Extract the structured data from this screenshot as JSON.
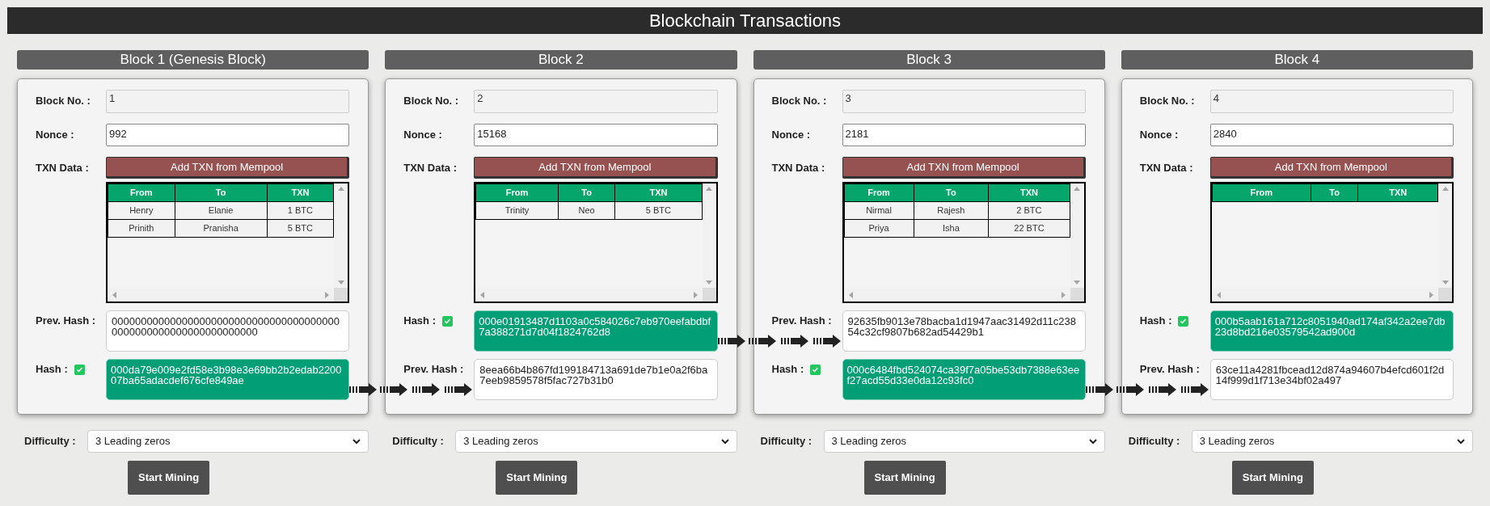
{
  "title": "Blockchain Transactions",
  "blocks": [
    {
      "header": "Block 1 (Genesis Block)",
      "block_no_label": "Block No. :",
      "block_no": "1",
      "nonce_label": "Nonce :",
      "nonce": "992",
      "txn_label": "TXN Data :",
      "add_button": "Add TXN from Mempool",
      "columns": [
        "From",
        "To",
        "TXN"
      ],
      "rows": [
        [
          "Henry",
          "Elanie",
          "1 BTC"
        ],
        [
          "Prinith",
          "Pranisha",
          "5 BTC"
        ]
      ],
      "fields": [
        {
          "kind": "prev_hash",
          "label": "Prev. Hash :",
          "value": "0000000000000000000000000000000000000000000000000000000000000000"
        },
        {
          "kind": "hash",
          "label": "Hash :",
          "checked": true,
          "value": "000da79e009e2fd58e3b98e3e69bb2b2edab220007ba65adacdef676cfe849ae"
        }
      ],
      "difficulty_label": "Difficulty :",
      "difficulty": "3 Leading zeros",
      "mine_button": "Start Mining"
    },
    {
      "header": "Block 2",
      "block_no_label": "Block No. :",
      "block_no": "2",
      "nonce_label": "Nonce :",
      "nonce": "15168",
      "txn_label": "TXN Data :",
      "add_button": "Add TXN from Mempool",
      "columns": [
        "From",
        "To",
        "TXN"
      ],
      "rows": [
        [
          "Trinity",
          "Neo",
          "5 BTC"
        ]
      ],
      "fields": [
        {
          "kind": "hash",
          "label": "Hash :",
          "checked": true,
          "value": "000e01913487d1103a0c584026c7eb970eefabdbf7a388271d7d04f1824762d8"
        },
        {
          "kind": "prev_hash",
          "label": "Prev. Hash :",
          "value": "8eea66b4b867fd199184713a691de7b1e0a2f6ba7eeb9859578f5fac727b31b0"
        }
      ],
      "difficulty_label": "Difficulty :",
      "difficulty": "3 Leading zeros",
      "mine_button": "Start Mining"
    },
    {
      "header": "Block 3",
      "block_no_label": "Block No. :",
      "block_no": "3",
      "nonce_label": "Nonce :",
      "nonce": "2181",
      "txn_label": "TXN Data :",
      "add_button": "Add TXN from Mempool",
      "columns": [
        "From",
        "To",
        "TXN"
      ],
      "rows": [
        [
          "Nirmal",
          "Rajesh",
          "2 BTC"
        ],
        [
          "Priya",
          "Isha",
          "22 BTC"
        ]
      ],
      "fields": [
        {
          "kind": "prev_hash",
          "label": "Prev. Hash :",
          "value": "92635fb9013e78bacba1d1947aac31492d11c23854c32cf9807b682ad54429b1"
        },
        {
          "kind": "hash",
          "label": "Hash :",
          "checked": true,
          "value": "000c6484fbd524074ca39f7a05be53db7388e63eef27acd55d33e0da12c93fc0"
        }
      ],
      "difficulty_label": "Difficulty :",
      "difficulty": "3 Leading zeros",
      "mine_button": "Start Mining"
    },
    {
      "header": "Block 4",
      "block_no_label": "Block No. :",
      "block_no": "4",
      "nonce_label": "Nonce :",
      "nonce": "2840",
      "txn_label": "TXN Data :",
      "add_button": "Add TXN from Mempool",
      "columns": [
        "From",
        "To",
        "TXN"
      ],
      "fields": [
        {
          "kind": "hash",
          "label": "Hash :",
          "checked": true,
          "value": "000b5aab161a712c8051940ad174af342a2ee7db23d8bd216e03579542ad900d"
        },
        {
          "kind": "prev_hash",
          "label": "Prev. Hash :",
          "value": "63ce11a4281fbcead12d874a94607b4efcd601f2d14f999d1f713e34bf02a497"
        }
      ],
      "difficulty_label": "Difficulty :",
      "difficulty": "3 Leading zeros",
      "mine_button": "Start Mining"
    }
  ]
}
